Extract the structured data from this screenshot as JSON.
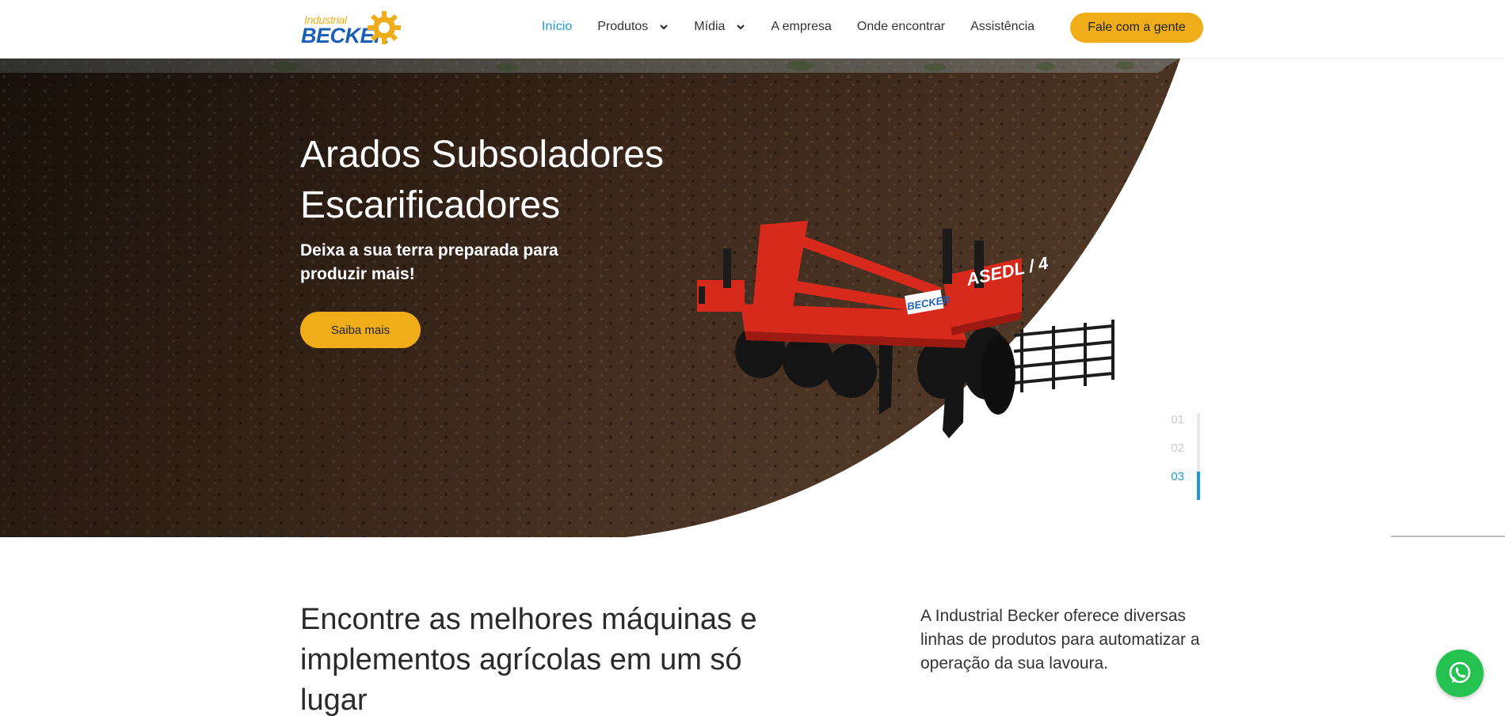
{
  "header": {
    "logo_text_small": "Industrial",
    "logo_text_big": "BECKER",
    "nav": [
      {
        "label": "Início",
        "active": true,
        "has_dropdown": false
      },
      {
        "label": "Produtos",
        "active": false,
        "has_dropdown": true
      },
      {
        "label": "Mídia",
        "active": false,
        "has_dropdown": true
      },
      {
        "label": "A empresa",
        "active": false,
        "has_dropdown": false
      },
      {
        "label": "Onde encontrar",
        "active": false,
        "has_dropdown": false
      },
      {
        "label": "Assistência",
        "active": false,
        "has_dropdown": false
      }
    ],
    "cta_label": "Fale com a gente"
  },
  "hero": {
    "title_line1": "Arados Subsoladores",
    "title_line2": "Escarificadores",
    "subtitle": "Deixa a sua terra preparada para produzir mais!",
    "button_label": "Saiba mais",
    "machine_label": "ASEDL / 4",
    "slides": [
      "01",
      "02",
      "03"
    ],
    "active_slide": 3
  },
  "intro": {
    "title": "Encontre as melhores máquinas e implementos agrícolas em um só lugar",
    "text": "A Industrial Becker oferece diversas linhas de produtos para automatizar a operação da sua lavoura."
  },
  "colors": {
    "accent": "#f0ad1a",
    "link_active": "#1b9ad6",
    "whatsapp": "#25c252",
    "logo_blue": "#1d5fb5"
  },
  "icons": {
    "dropdown": "chevron-down-icon",
    "chat": "whatsapp-icon"
  }
}
